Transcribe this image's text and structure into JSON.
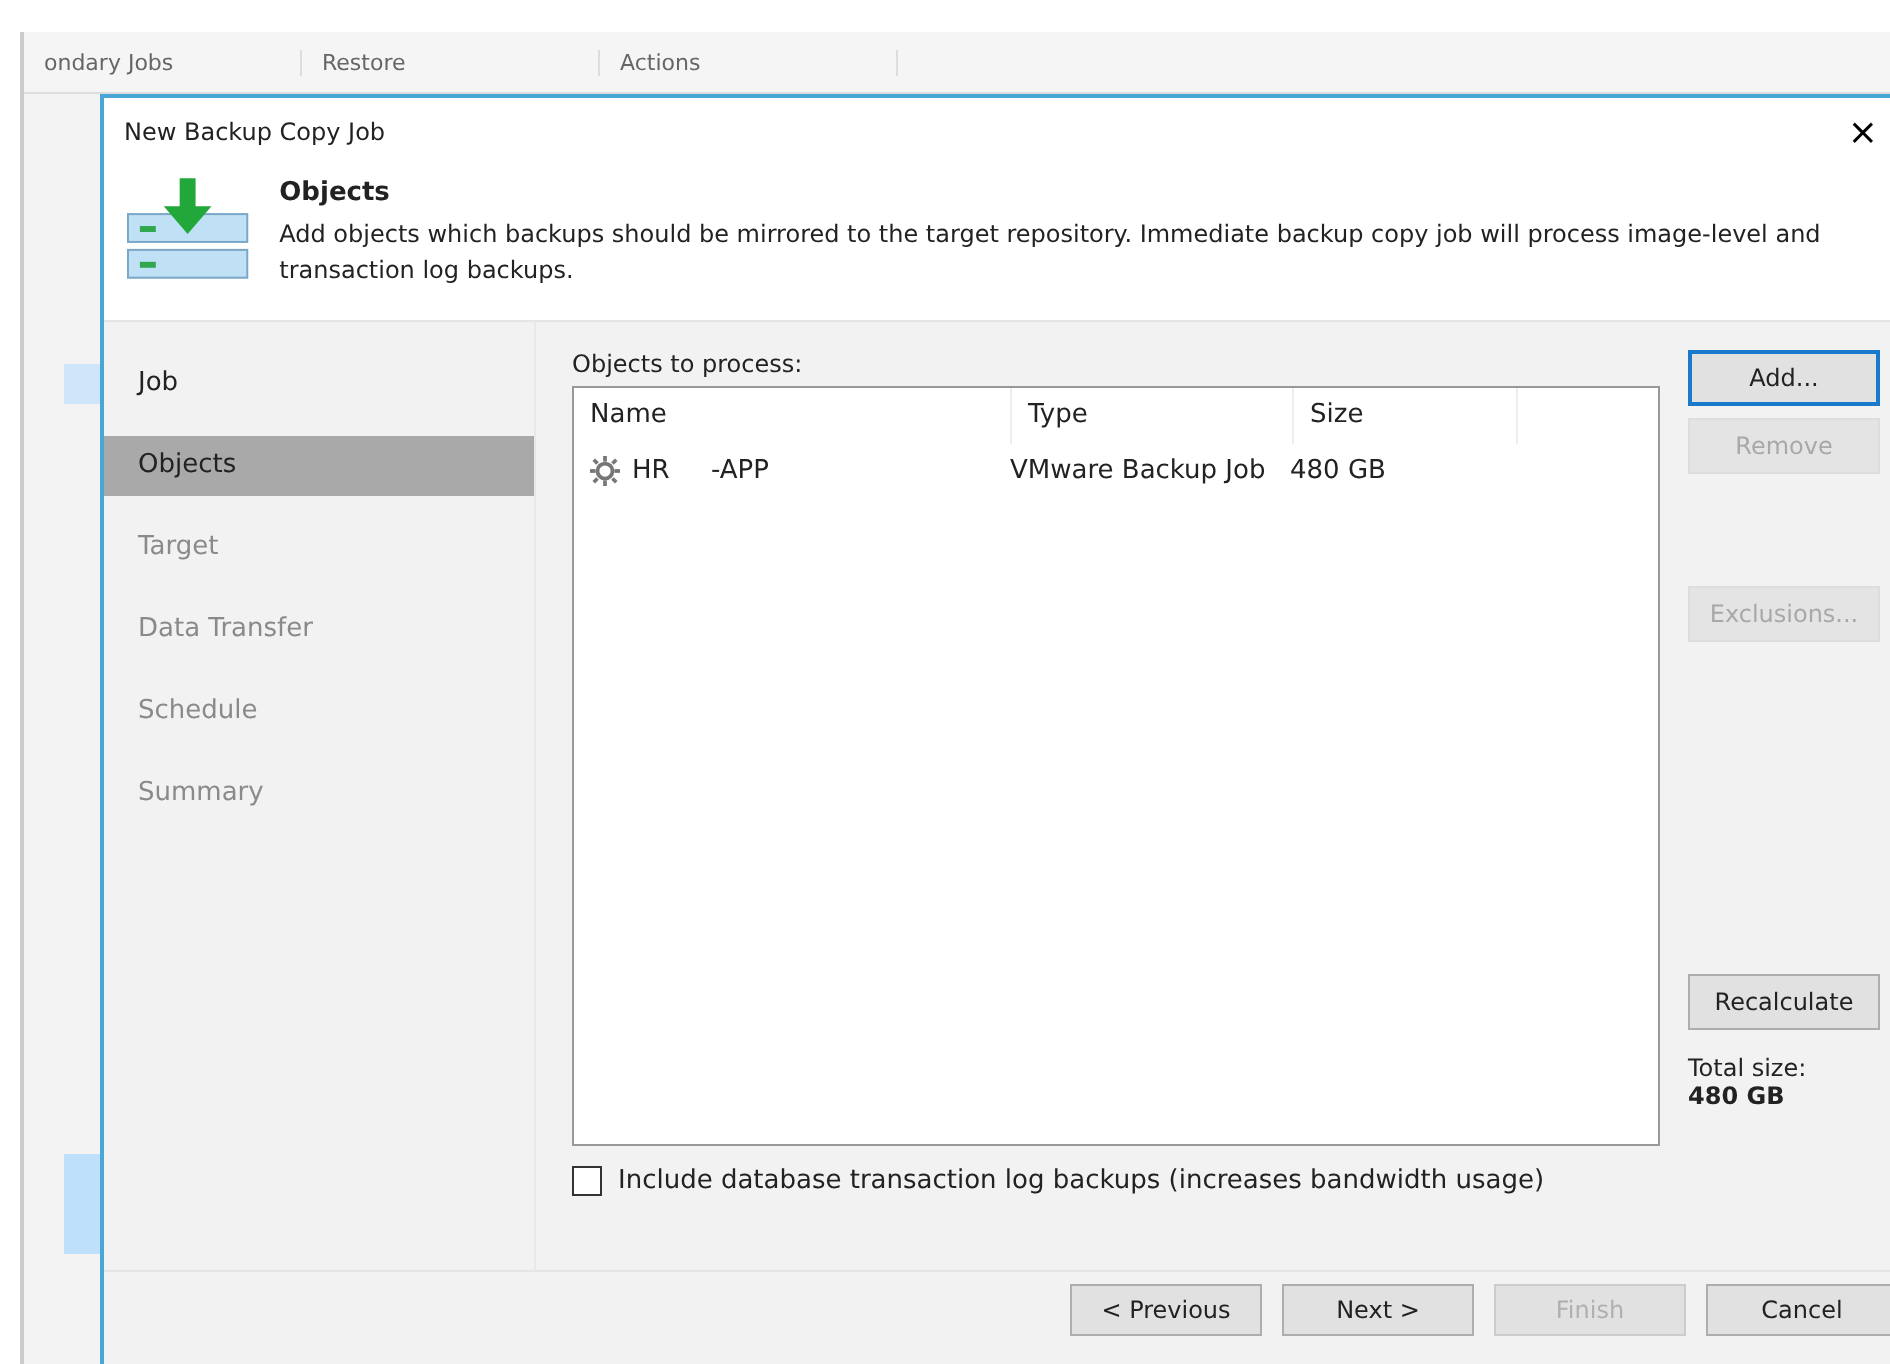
{
  "background_tabs": [
    "ondary Jobs",
    "Restore",
    "Actions"
  ],
  "window": {
    "title": "New Backup Copy Job",
    "close": "×"
  },
  "header": {
    "title": "Objects",
    "description": "Add objects which backups should be mirrored to the target repository. Immediate backup copy job will process image-level and transaction log backups."
  },
  "steps": [
    {
      "label": "Job",
      "selected": false,
      "disabled": false
    },
    {
      "label": "Objects",
      "selected": true,
      "disabled": false
    },
    {
      "label": "Target",
      "selected": false,
      "disabled": true
    },
    {
      "label": "Data Transfer",
      "selected": false,
      "disabled": true
    },
    {
      "label": "Schedule",
      "selected": false,
      "disabled": true
    },
    {
      "label": "Summary",
      "selected": false,
      "disabled": true
    }
  ],
  "objects": {
    "label": "Objects to process:",
    "columns": [
      "Name",
      "Type",
      "Size"
    ],
    "rows": [
      {
        "name": "HR     -APP",
        "type": "VMware Backup Job",
        "size": "480 GB"
      }
    ]
  },
  "side_buttons": [
    {
      "label": "Add...",
      "disabled": false,
      "focused": true
    },
    {
      "label": "Remove",
      "disabled": true,
      "focused": false
    },
    {
      "label": "Exclusions...",
      "disabled": true,
      "focused": false
    },
    {
      "label": "Recalculate",
      "disabled": false,
      "focused": false
    }
  ],
  "total": {
    "label": "Total size:",
    "value": "480 GB"
  },
  "include_logs": {
    "label": "Include database transaction log backups (increases bandwidth usage)",
    "checked": false
  },
  "footer_buttons": [
    {
      "label": "< Previous",
      "disabled": false
    },
    {
      "label": "Next >",
      "disabled": false
    },
    {
      "label": "Finish",
      "disabled": true
    },
    {
      "label": "Cancel",
      "disabled": false
    }
  ]
}
